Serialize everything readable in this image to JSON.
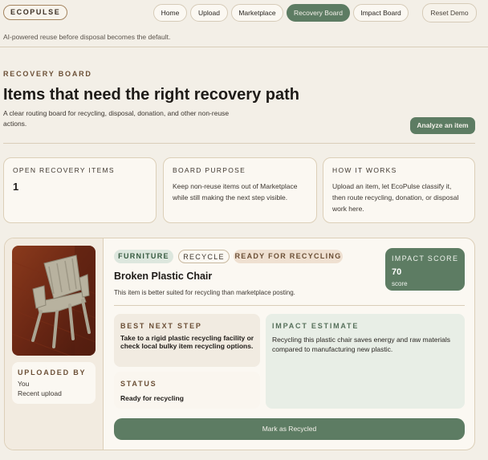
{
  "header": {
    "brand": "ECOPULSE",
    "tagline": "AI-powered reuse before disposal becomes the default.",
    "nav": [
      "Home",
      "Upload",
      "Marketplace",
      "Recovery Board",
      "Impact Board"
    ],
    "active_nav": "Recovery Board",
    "reset_label": "Reset Demo"
  },
  "hero": {
    "eyebrow": "RECOVERY BOARD",
    "title": "Items that need the right recovery path",
    "subtitle": "A clear routing board for recycling, disposal, donation, and other non-reuse actions.",
    "cta_label": "Analyze an item"
  },
  "info_cards": [
    {
      "label": "OPEN RECOVERY ITEMS",
      "value": "1"
    },
    {
      "label": "BOARD PURPOSE",
      "text": "Keep non-reuse items out of Marketplace while still making the next step visible."
    },
    {
      "label": "HOW IT WORKS",
      "text": "Upload an item, let EcoPulse classify it, then route recycling, donation, or disposal work here."
    }
  ],
  "item": {
    "tags": {
      "category": "FURNITURE",
      "action": "RECYCLE",
      "status": "READY FOR RECYCLING"
    },
    "title": "Broken Plastic Chair",
    "description": "This item is better suited for recycling than marketplace posting.",
    "impact": {
      "label": "IMPACT SCORE",
      "value": "70",
      "unit": "score"
    },
    "uploaded": {
      "label": "UPLOADED BY",
      "by": "You",
      "when": "Recent upload"
    },
    "next_step": {
      "label": "BEST NEXT STEP",
      "text": "Take to a rigid plastic recycling facility or check local bulky item recycling options."
    },
    "status": {
      "label": "STATUS",
      "text": "Ready for recycling"
    },
    "estimate": {
      "label": "IMPACT ESTIMATE",
      "text": "Recycling this plastic chair saves energy and raw materials compared to manufacturing new plastic."
    },
    "action_label": "Mark as Recycled"
  },
  "colors": {
    "accent": "#5d7c63",
    "background": "#f3efe7",
    "card": "#fbf8f2",
    "eyebrow": "#6b4f36"
  }
}
